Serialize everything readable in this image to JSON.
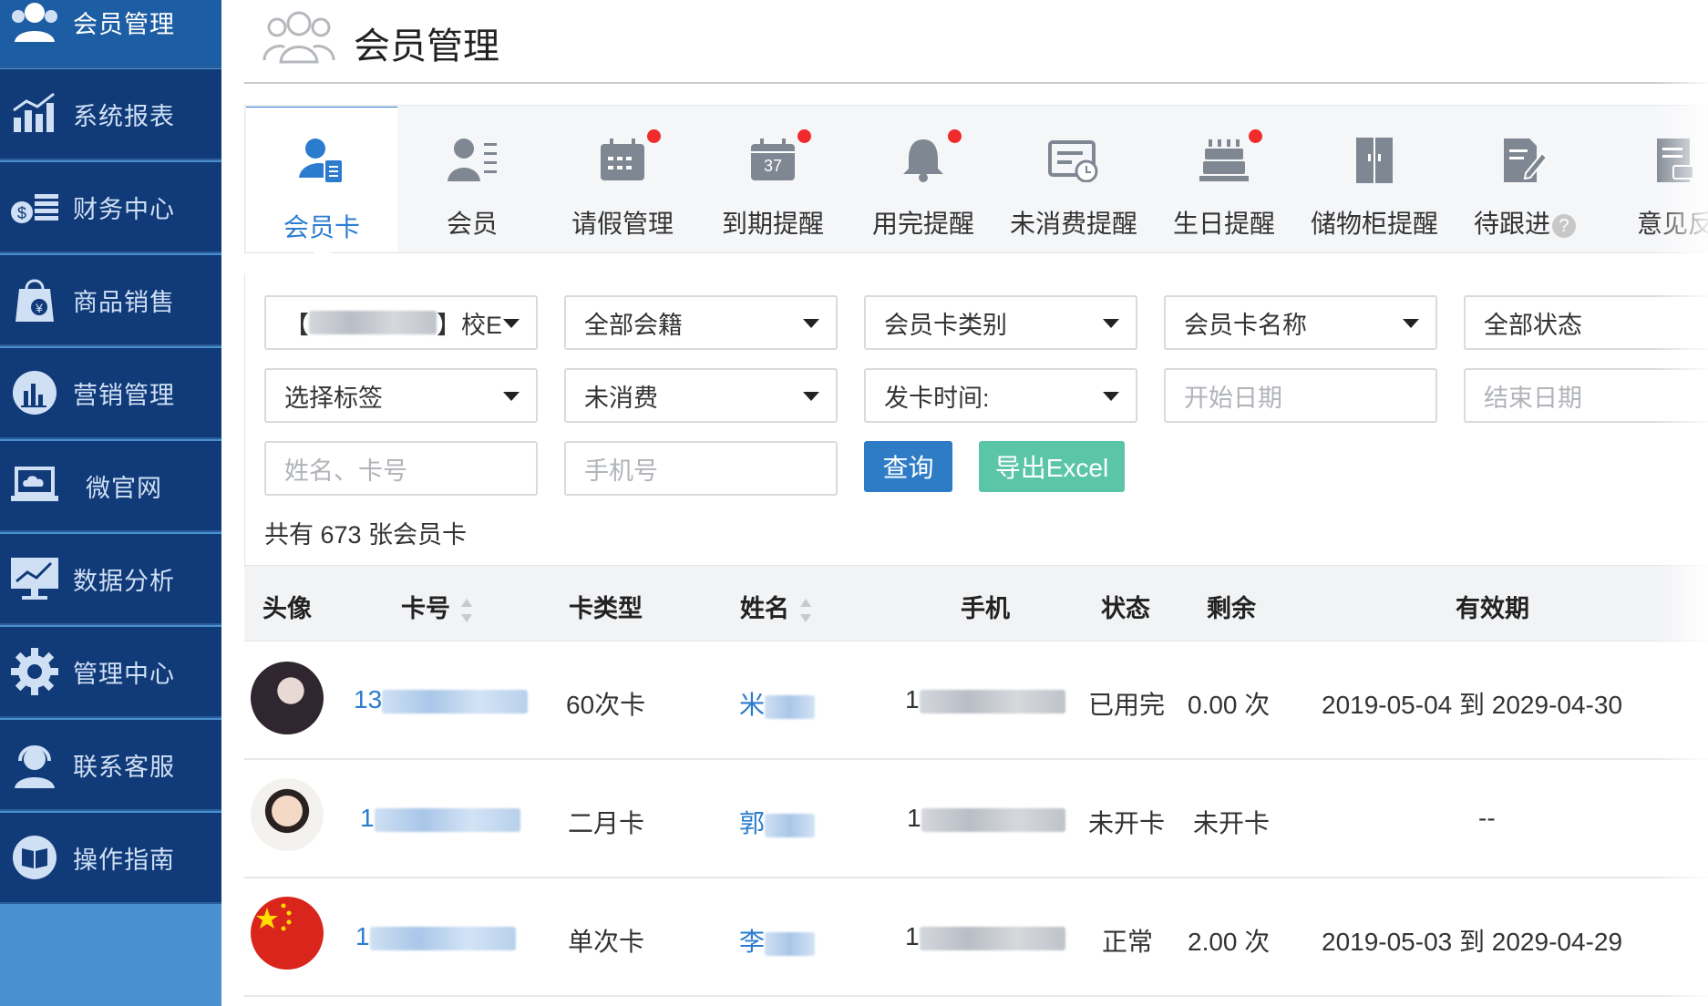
{
  "sidebar": {
    "items": [
      {
        "label": "会员管理",
        "icon": "members-icon"
      },
      {
        "label": "系统报表",
        "icon": "report-chart-icon"
      },
      {
        "label": "财务中心",
        "icon": "finance-coins-icon"
      },
      {
        "label": "商品销售",
        "icon": "shopping-bag-icon"
      },
      {
        "label": "营销管理",
        "icon": "bar-chart-icon"
      },
      {
        "label": "微官网",
        "icon": "laptop-cloud-icon"
      },
      {
        "label": "数据分析",
        "icon": "monitor-chart-icon"
      },
      {
        "label": "管理中心",
        "icon": "gear-icon"
      },
      {
        "label": "联系客服",
        "icon": "headset-icon"
      },
      {
        "label": "操作指南",
        "icon": "book-icon"
      }
    ]
  },
  "header": {
    "title": "会员管理"
  },
  "tabs": [
    {
      "label": "会员卡",
      "active": true
    },
    {
      "label": "会员"
    },
    {
      "label": "请假管理",
      "dot": true
    },
    {
      "label": "到期提醒",
      "dot": true,
      "icon_text": "37"
    },
    {
      "label": "用完提醒",
      "dot": true
    },
    {
      "label": "未消费提醒"
    },
    {
      "label": "生日提醒",
      "dot": true
    },
    {
      "label": "储物柜提醒"
    },
    {
      "label": "待跟进",
      "help": "?"
    },
    {
      "label": "意见反"
    }
  ],
  "filters": {
    "campus_prefix": "【",
    "campus_suffix": "】校E",
    "membership": "全部会籍",
    "card_type": "会员卡类别",
    "card_name": "会员卡名称",
    "status": "全部状态",
    "tag": "选择标签",
    "consumption": "未消费",
    "issue_time": "发卡时间:",
    "start_date_placeholder": "开始日期",
    "end_date_placeholder": "结束日期",
    "name_placeholder": "姓名、卡号",
    "phone_placeholder": "手机号",
    "query_label": "查询",
    "excel_label": "导出Excel"
  },
  "summary": {
    "count_text": "共有 673 张会员卡"
  },
  "table": {
    "headers": {
      "avatar": "头像",
      "card_no": "卡号",
      "card_type": "卡类型",
      "name": "姓名",
      "phone": "手机",
      "status": "状态",
      "remaining": "剩余",
      "validity": "有效期"
    },
    "rows": [
      {
        "card_no_prefix": "13",
        "card_type": "60次卡",
        "name_prefix": "米",
        "phone_prefix": "1",
        "status": "已用完",
        "remaining": "0.00 次",
        "validity": "2019-05-04 到 2029-04-30"
      },
      {
        "card_no_prefix": "1",
        "card_type": "二月卡",
        "name_prefix": "郭",
        "phone_prefix": "1",
        "status": "未开卡",
        "remaining": "未开卡",
        "validity": "--"
      },
      {
        "card_no_prefix": "1",
        "card_type": "单次卡",
        "name_prefix": "李",
        "phone_prefix": "1",
        "status": "正常",
        "remaining": "2.00 次",
        "validity": "2019-05-03 到 2029-04-29"
      }
    ]
  },
  "colors": {
    "sidebar_bg": "#113a78",
    "sidebar_active": "#1d5da3",
    "accent": "#2b7ccf",
    "excel_green": "#5bc5a7",
    "badge_red": "#f02b2b"
  }
}
